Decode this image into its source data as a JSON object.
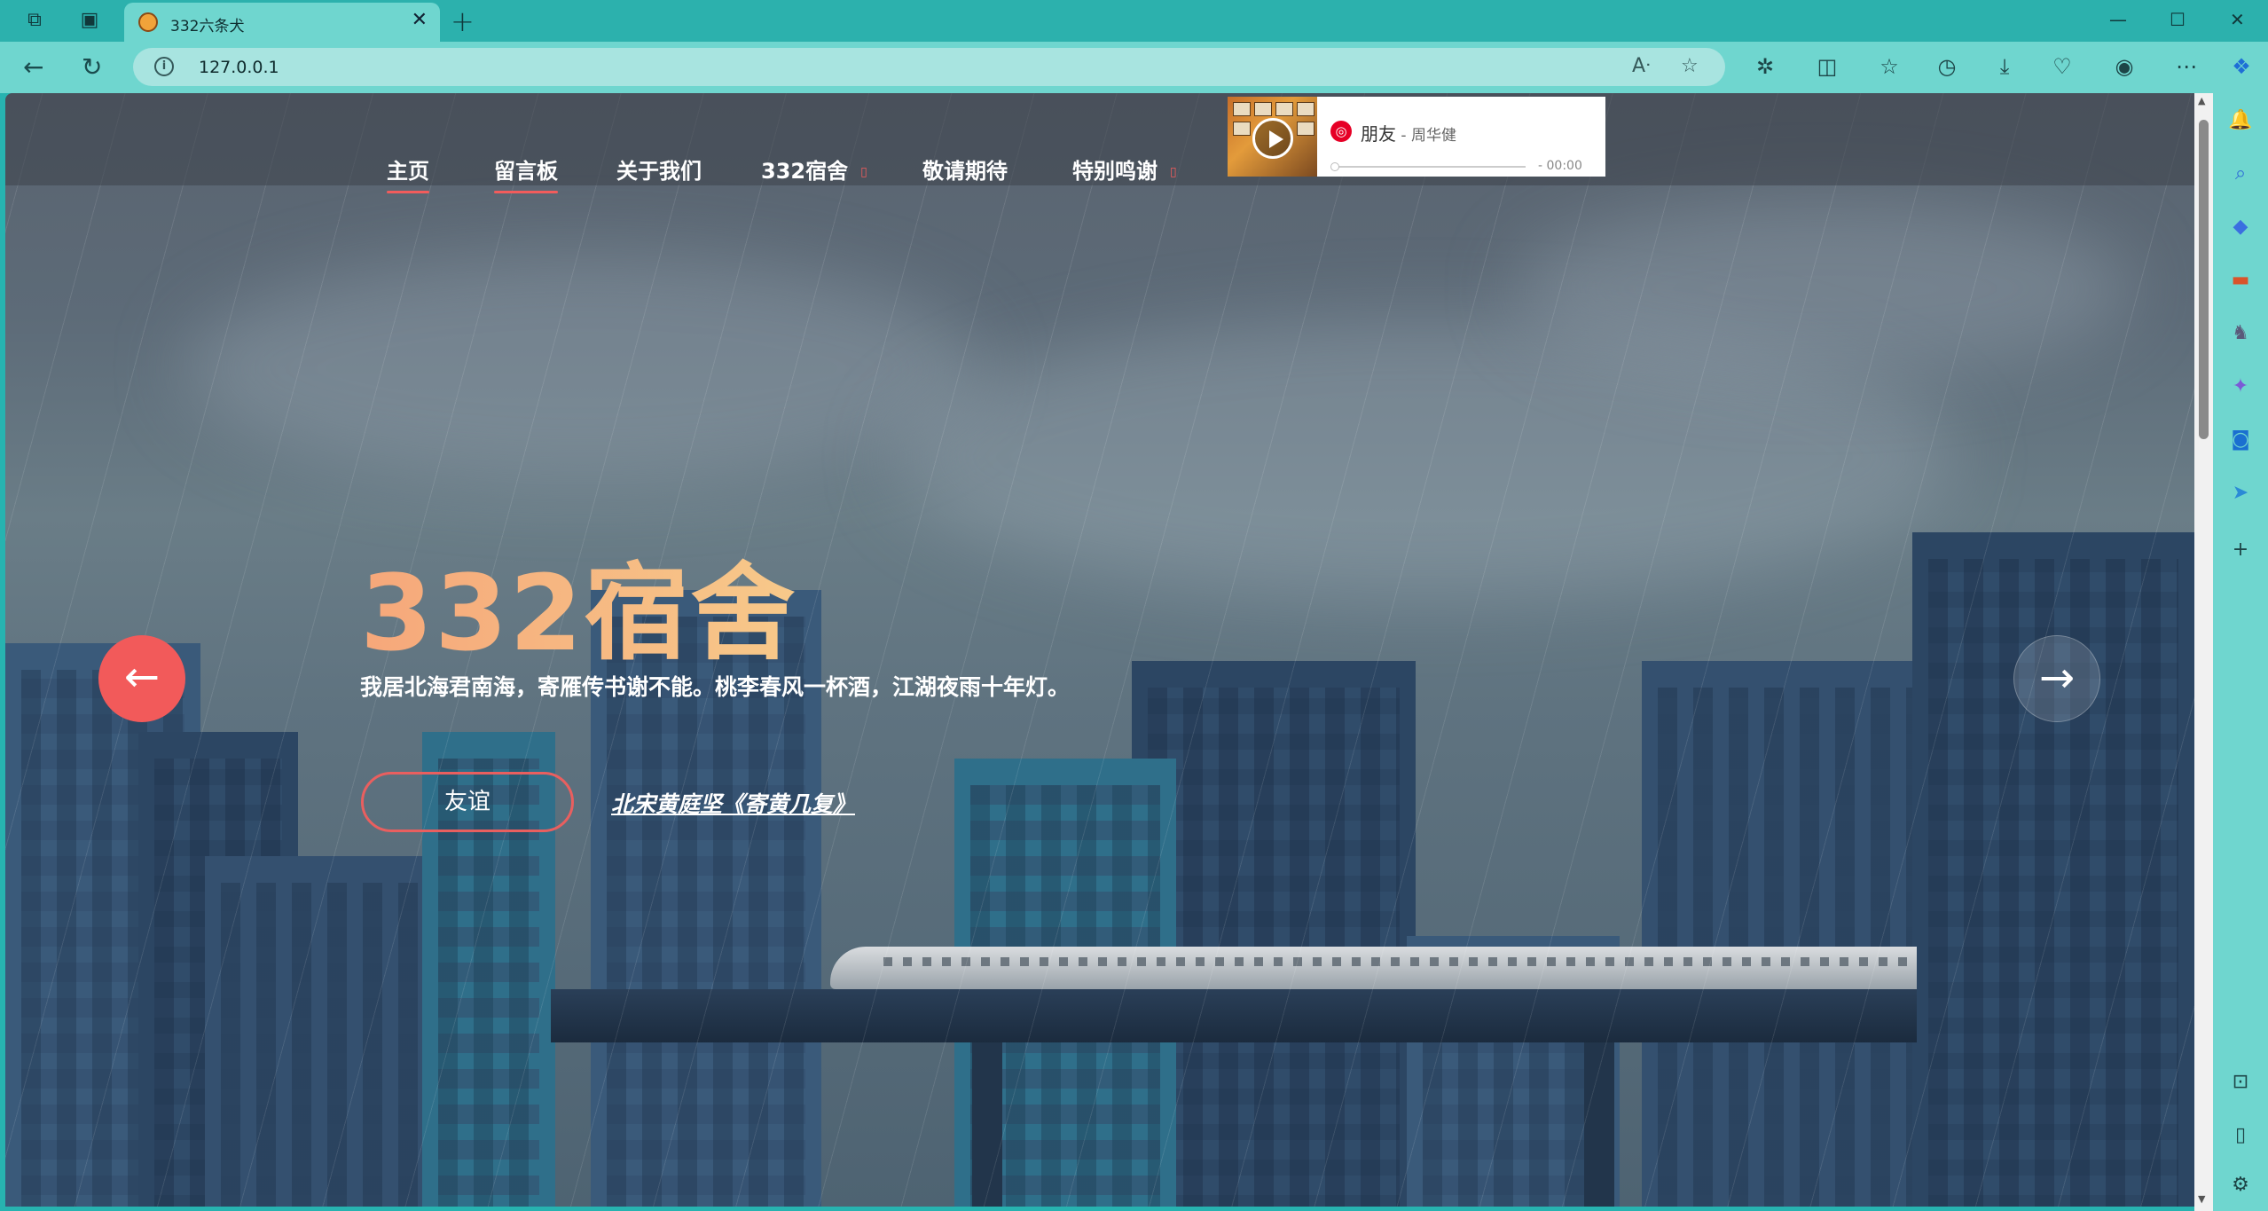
{
  "browser": {
    "tab_title": "332六条犬",
    "tab_close": "✕",
    "new_tab": "+",
    "url": "127.0.0.1",
    "window_minimize": "—",
    "window_maximize": "☐",
    "window_close": "✕",
    "read_aloud_icon": "Aᐧ",
    "favorite_icon": "☆",
    "more_icon": "⋯"
  },
  "nav": {
    "items": [
      {
        "label": "主页",
        "active": true
      },
      {
        "label": "留言板",
        "active": true
      },
      {
        "label": "关于我们",
        "active": false
      },
      {
        "label": "332宿舍",
        "active": false,
        "has_dropdown": true
      },
      {
        "label": "敬请期待",
        "active": false
      },
      {
        "label": "特别鸣谢",
        "active": false,
        "has_dropdown": true
      }
    ],
    "dropdown_glyph": "▯",
    "accent_color": "#f25c5c"
  },
  "music": {
    "song": "朋友",
    "separator": " - ",
    "artist": "周华健",
    "time": "- 00:00",
    "logo": "◎"
  },
  "hero": {
    "title": "332宿舍",
    "subtitle": "我居北海君南海，寄雁传书谢不能。桃李春风一杯酒，江湖夜雨十年灯。",
    "button_label": "友谊",
    "poem_link": "北宋黄庭坚《寄黄几复》",
    "prev_arrow": "←",
    "next_arrow": "→"
  },
  "icons": {
    "sidebar": [
      "bell-icon",
      "search-icon",
      "tag-icon",
      "briefcase-icon",
      "chess-icon",
      "copilot-icon",
      "outlook-icon",
      "send-icon",
      "add-icon",
      "screenshot-icon",
      "split-icon",
      "settings-icon"
    ]
  }
}
